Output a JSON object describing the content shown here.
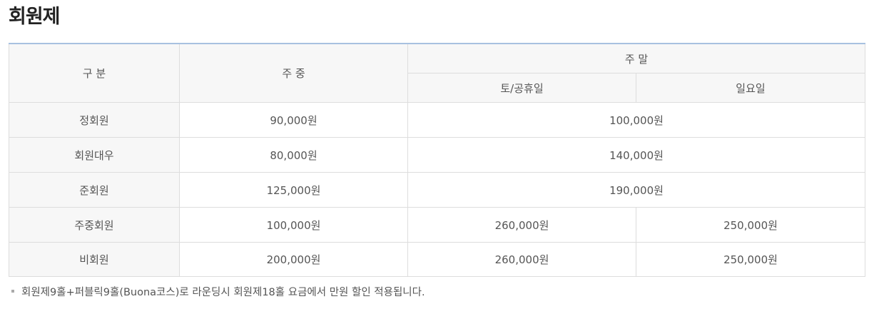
{
  "title": "회원제",
  "table": {
    "headers": {
      "category": "구 분",
      "weekday": "주 중",
      "weekend": "주 말",
      "saturday_holiday": "토/공휴일",
      "sunday": "일요일"
    },
    "rows": [
      {
        "label": "정회원",
        "weekday": "90,000원",
        "weekend": "100,000원"
      },
      {
        "label": "회원대우",
        "weekday": "80,000원",
        "weekend": "140,000원"
      },
      {
        "label": "준회원",
        "weekday": "125,000원",
        "weekend": "190,000원"
      },
      {
        "label": "주중회원",
        "weekday": "100,000원",
        "saturday_holiday": "260,000원",
        "sunday": "250,000원"
      },
      {
        "label": "비회원",
        "weekday": "200,000원",
        "saturday_holiday": "260,000원",
        "sunday": "250,000원"
      }
    ]
  },
  "note": "회원제9홀+퍼블릭9홀(Buona코스)로 라운딩시 회원제18홀 요금에서 만원 할인 적용됩니다."
}
